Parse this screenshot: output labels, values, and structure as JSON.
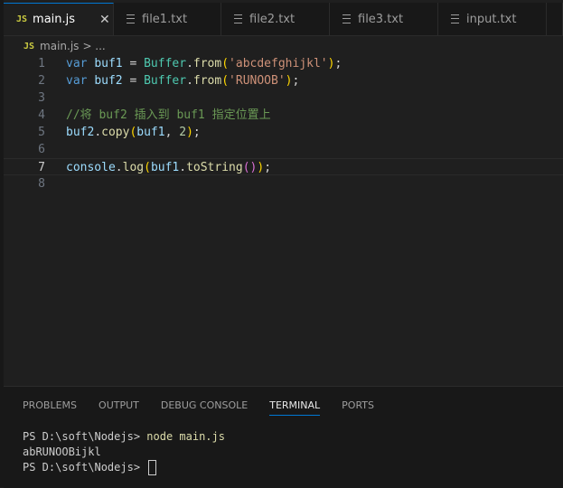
{
  "tabs": [
    {
      "label": "main.js",
      "icon": "JS",
      "active": true
    },
    {
      "label": "file1.txt"
    },
    {
      "label": "file2.txt"
    },
    {
      "label": "file3.txt"
    },
    {
      "label": "input.txt"
    }
  ],
  "breadcrumb": {
    "icon": "JS",
    "file": "main.js",
    "rest": "> ..."
  },
  "editor": {
    "current_line": 7,
    "line_numbers": [
      "1",
      "2",
      "3",
      "4",
      "5",
      "6",
      "7",
      "8"
    ]
  },
  "code": {
    "l1": {
      "kw": "var",
      "var": "buf1",
      "op": " = ",
      "cls": "Buffer",
      "dot": ".",
      "fn": "from",
      "po": "(",
      "str": "'abcdefghijkl'",
      "pc": ")",
      "end": ";"
    },
    "l2": {
      "kw": "var",
      "var": "buf2",
      "op": " = ",
      "cls": "Buffer",
      "dot": ".",
      "fn": "from",
      "po": "(",
      "str": "'RUNOOB'",
      "pc": ")",
      "end": ";"
    },
    "l4": {
      "comment": "//将 buf2 插入到 buf1 指定位置上"
    },
    "l5": {
      "obj": "buf2",
      "dot": ".",
      "fn": "copy",
      "po": "(",
      "arg1": "buf1",
      "sep": ", ",
      "num": "2",
      "pc": ")",
      "end": ";"
    },
    "l7": {
      "obj": "console",
      "dot": ".",
      "fn": "log",
      "po": "(",
      "arg": "buf1",
      "dot2": ".",
      "fn2": "toString",
      "io": "(",
      "ic": ")",
      "pc": ")",
      "end": ";"
    }
  },
  "panel": {
    "tabs": [
      "PROBLEMS",
      "OUTPUT",
      "DEBUG CONSOLE",
      "TERMINAL",
      "PORTS"
    ],
    "active_tab": "TERMINAL"
  },
  "terminal": {
    "prompt": "PS D:\\soft\\Nodejs> ",
    "command": "node main.js",
    "output": "abRUNOOBijkl",
    "prompt2": "PS D:\\soft\\Nodejs> "
  }
}
